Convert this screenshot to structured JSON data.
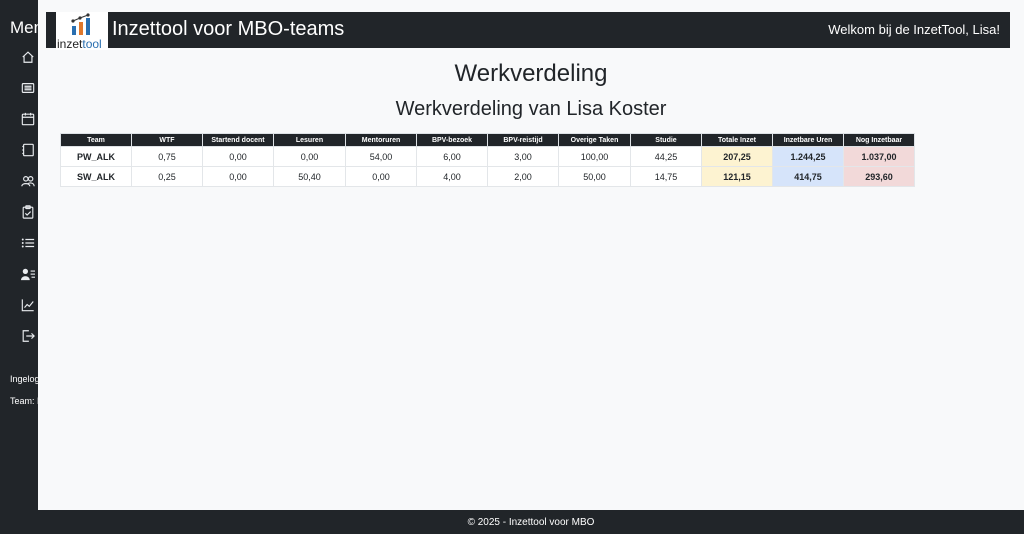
{
  "sidebar": {
    "menu_title": "Menu",
    "items": [
      {
        "icon": "home-icon"
      },
      {
        "icon": "list-icon"
      },
      {
        "icon": "calendar-icon"
      },
      {
        "icon": "book-icon"
      },
      {
        "icon": "users-icon"
      },
      {
        "icon": "clipboard-check-icon"
      },
      {
        "icon": "list-ul-icon"
      },
      {
        "icon": "user-list-icon"
      },
      {
        "icon": "chart-line-icon"
      },
      {
        "icon": "logout-icon"
      }
    ],
    "logged_in": "Ingelogd als: Lisa Koster",
    "team": "Team: PW_ALK"
  },
  "header": {
    "logo_text_prefix": "inzet",
    "logo_text_accent": "tool",
    "app_title": "Inzettool voor MBO-teams",
    "welcome": "Welkom bij de InzetTool, Lisa!"
  },
  "main": {
    "title": "Werkverdeling",
    "subtitle": "Werkverdeling van Lisa Koster",
    "table": {
      "headers": [
        "Team",
        "WTF",
        "Startend docent",
        "Lesuren",
        "Mentoruren",
        "BPV-bezoek",
        "BPV-reistijd",
        "Overige Taken",
        "Studie",
        "Totale Inzet",
        "Inzetbare Uren",
        "Nog Inzetbaar"
      ],
      "rows": [
        [
          "PW_ALK",
          "0,75",
          "0,00",
          "0,00",
          "54,00",
          "6,00",
          "3,00",
          "100,00",
          "44,25",
          "207,25",
          "1.244,25",
          "1.037,00"
        ],
        [
          "SW_ALK",
          "0,25",
          "0,00",
          "50,40",
          "0,00",
          "4,00",
          "2,00",
          "50,00",
          "14,75",
          "121,15",
          "414,75",
          "293,60"
        ]
      ]
    }
  },
  "footer": {
    "text": "© 2025 - Inzettool voor MBO"
  },
  "colors": {
    "dark": "#212529",
    "background": "#f8f9fa",
    "totale_inzet": "#fdf3d1",
    "inzetbare_uren": "#d6e4fa",
    "nog_inzetbaar": "#f2d9d9"
  }
}
